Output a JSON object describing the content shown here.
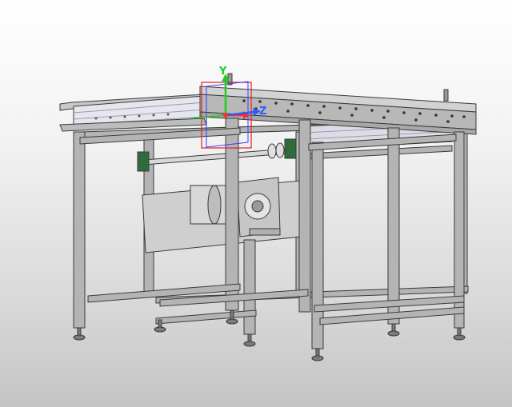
{
  "viewport": {
    "name": "cad-3d-viewport",
    "background_top": "#ffffff",
    "background_bottom": "#c4c4c4"
  },
  "model": {
    "frame_color": "#b4b4b4",
    "edge_color": "#3a3a3a",
    "roller_color": "#e6e6ef",
    "motor_color": "#cfcfcf"
  },
  "triad": {
    "x_label": "",
    "y_label": "Y",
    "z_label": "Z",
    "x_color": "#ff2a2a",
    "y_color": "#22cc22",
    "z_color": "#2a5cff",
    "bbox_color": "#e0202a",
    "plane_color": "#3a3aff"
  }
}
